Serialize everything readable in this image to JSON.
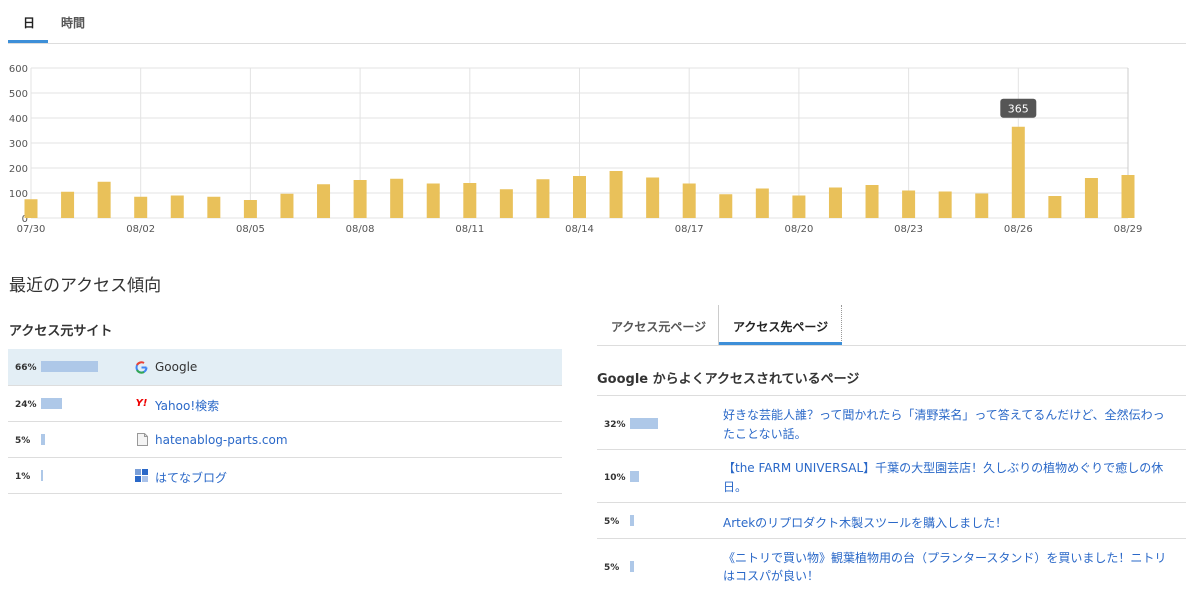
{
  "top_tabs": [
    "日",
    "時間"
  ],
  "chart_data": {
    "type": "bar",
    "categories": [
      "07/30",
      "07/31",
      "08/01",
      "08/02",
      "08/03",
      "08/04",
      "08/05",
      "08/06",
      "08/07",
      "08/08",
      "08/09",
      "08/10",
      "08/11",
      "08/12",
      "08/13",
      "08/14",
      "08/15",
      "08/16",
      "08/17",
      "08/18",
      "08/19",
      "08/20",
      "08/21",
      "08/22",
      "08/23",
      "08/24",
      "08/25",
      "08/26",
      "08/27",
      "08/28",
      "08/29"
    ],
    "x_tick_labels": [
      "07/30",
      "08/02",
      "08/05",
      "08/08",
      "08/11",
      "08/14",
      "08/17",
      "08/20",
      "08/23",
      "08/26",
      "08/29"
    ],
    "values": [
      75,
      105,
      145,
      85,
      90,
      85,
      72,
      97,
      135,
      152,
      157,
      138,
      140,
      115,
      155,
      168,
      188,
      162,
      138,
      95,
      118,
      90,
      122,
      132,
      110,
      106,
      98,
      365,
      88,
      160,
      172
    ],
    "y_ticks": [
      0,
      100,
      200,
      300,
      400,
      500,
      600
    ],
    "ylim": [
      0,
      600
    ],
    "grid": true,
    "bar_color": "#e9c15a",
    "tooltip": {
      "category": "08/26",
      "value": "365"
    }
  },
  "section_title": "最近のアクセス傾向",
  "referrer_sites": {
    "title": "アクセス元サイト",
    "items": [
      {
        "percent": "66%",
        "value": 66,
        "icon": "google-icon",
        "label": "Google"
      },
      {
        "percent": "24%",
        "value": 24,
        "icon": "yahoo-icon",
        "label": "Yahoo!検索"
      },
      {
        "percent": "5%",
        "value": 5,
        "icon": "document-icon",
        "label": "hatenablog-parts.com"
      },
      {
        "percent": "1%",
        "value": 1,
        "icon": "hatena-blog-icon",
        "label": "はてなブログ"
      }
    ]
  },
  "right_tabs": [
    "アクセス元ページ",
    "アクセス先ページ"
  ],
  "destination_pages": {
    "title": "Google からよくアクセスされているページ",
    "items": [
      {
        "percent": "32%",
        "value": 32,
        "line1": "好きな芸能人誰？って聞かれたら「清野菜名」って答えてるんだけど、全然伝わっ",
        "line2": "たことない話。"
      },
      {
        "percent": "10%",
        "value": 10,
        "line1": "【the FARM UNIVERSAL】千葉の大型園芸店！久しぶりの植物めぐりで癒しの休",
        "line2": "日。"
      },
      {
        "percent": "5%",
        "value": 5,
        "line1": "Artekのリプロダクト木製スツールを購入しました！",
        "line2": ""
      },
      {
        "percent": "5%",
        "value": 5,
        "line1": "《ニトリで買い物》観葉植物用の台（プランタースタンド）を買いました！ニトリ",
        "line2": "はコスパが良い！"
      }
    ]
  }
}
